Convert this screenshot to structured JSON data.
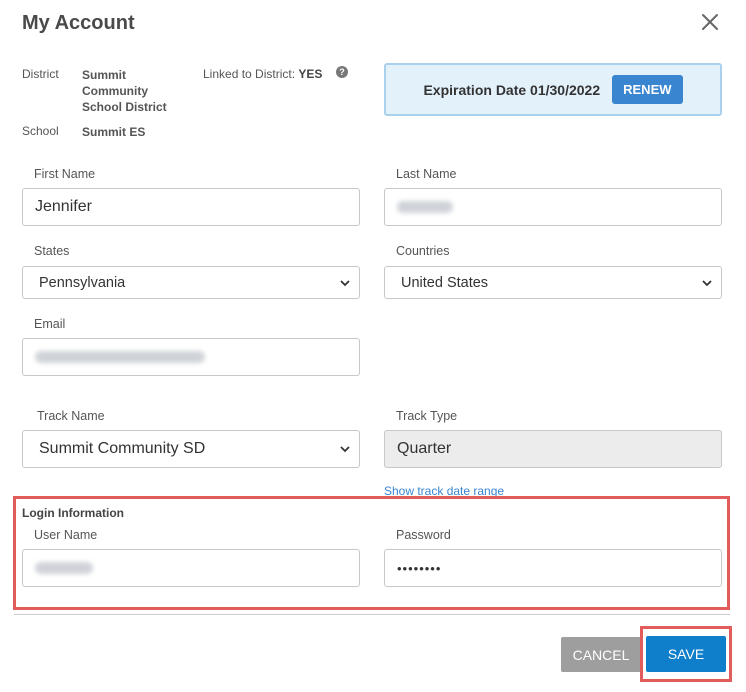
{
  "dialog": {
    "title": "My Account"
  },
  "meta": {
    "district_label": "District",
    "district_value": "Summit Community School District",
    "school_label": "School",
    "school_value": "Summit ES",
    "linked_label": "Linked to District:",
    "linked_value": "YES",
    "help_icon": "?"
  },
  "expiration": {
    "text": "Expiration Date 01/30/2022",
    "renew_label": "RENEW"
  },
  "form": {
    "first_name_label": "First Name",
    "first_name_value": "Jennifer",
    "last_name_label": "Last Name",
    "states_label": "States",
    "states_value": "Pennsylvania",
    "countries_label": "Countries",
    "countries_value": "United States",
    "email_label": "Email",
    "track_name_label": "Track Name",
    "track_name_value": "Summit Community SD",
    "track_type_label": "Track Type",
    "track_type_value": "Quarter",
    "show_track_link": "Show track date range"
  },
  "login": {
    "section_title": "Login Information",
    "username_label": "User Name",
    "password_label": "Password",
    "password_value": "••••••••"
  },
  "actions": {
    "cancel_label": "CANCEL",
    "save_label": "SAVE"
  },
  "colors": {
    "accent": "#0f7fcb",
    "highlight": "#e25c5c",
    "renew": "#3a85cf"
  }
}
